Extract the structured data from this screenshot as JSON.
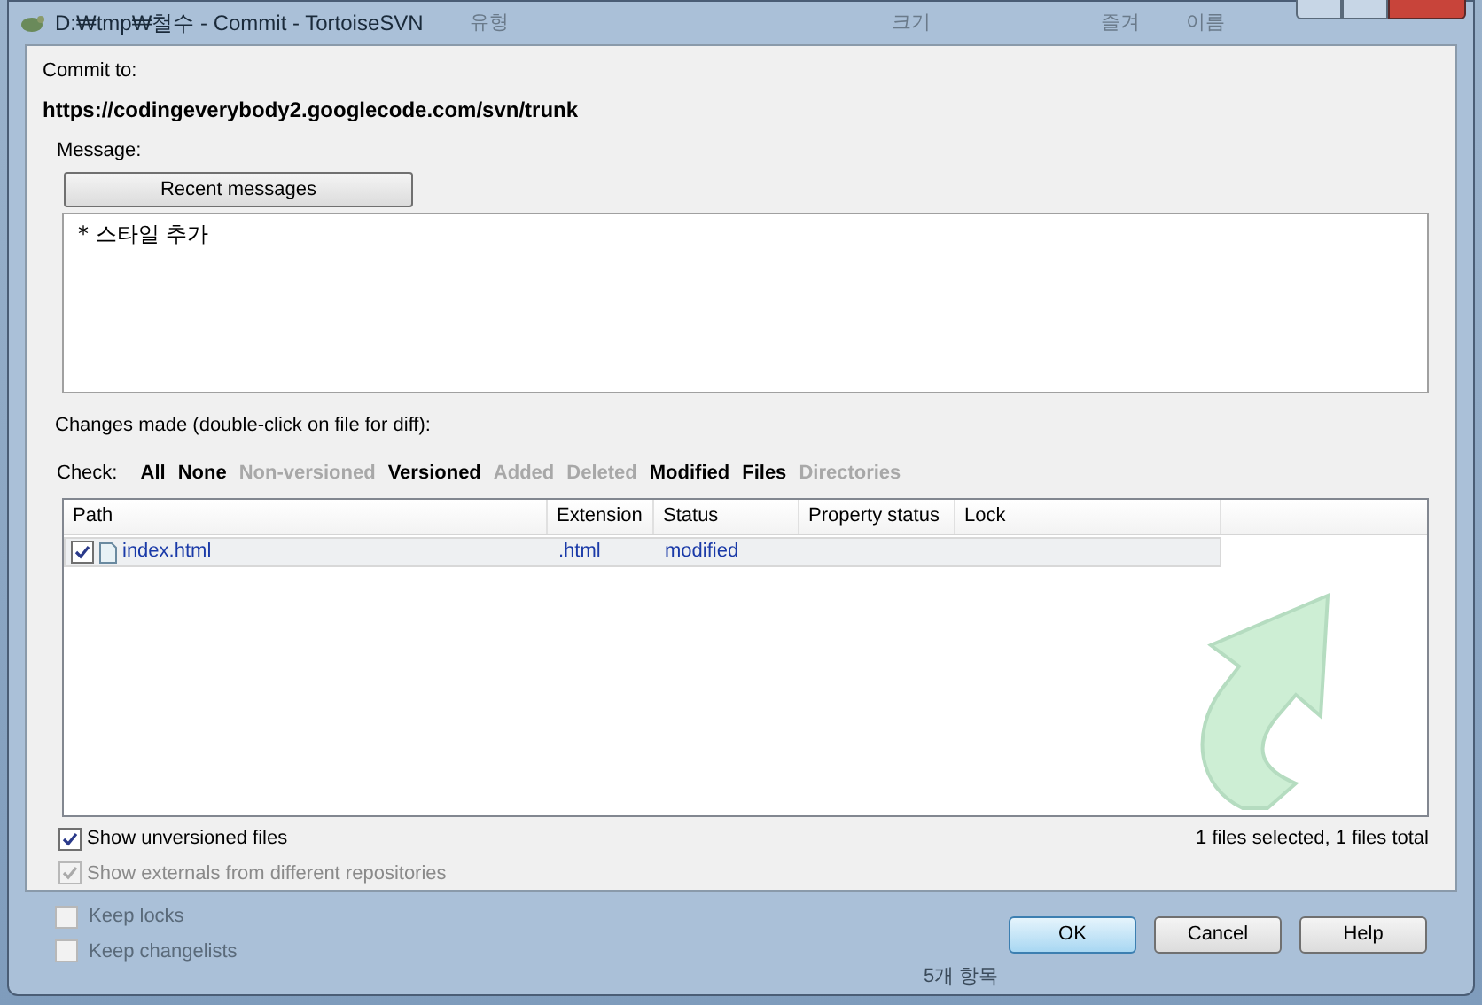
{
  "window": {
    "title": "D:₩tmp₩철수 - Commit - TortoiseSVN"
  },
  "background": {
    "header_texts": [
      "유형",
      "크기",
      "즐겨",
      "이름"
    ],
    "footer_text": "5개 항목"
  },
  "commit_to": {
    "label": "Commit to:",
    "url": "https://codingeverybody2.googlecode.com/svn/trunk"
  },
  "message": {
    "label": "Message:",
    "recent_button": "Recent messages",
    "value": "* 스타일 추가"
  },
  "changes": {
    "label": "Changes made (double-click on file for diff):",
    "check_label": "Check:",
    "filters": [
      {
        "label": "All",
        "enabled": true
      },
      {
        "label": "None",
        "enabled": true
      },
      {
        "label": "Non-versioned",
        "enabled": false
      },
      {
        "label": "Versioned",
        "enabled": true
      },
      {
        "label": "Added",
        "enabled": false
      },
      {
        "label": "Deleted",
        "enabled": false
      },
      {
        "label": "Modified",
        "enabled": true
      },
      {
        "label": "Files",
        "enabled": true
      },
      {
        "label": "Directories",
        "enabled": false
      }
    ],
    "columns": [
      "Path",
      "Extension",
      "Status",
      "Property status",
      "Lock"
    ],
    "rows": [
      {
        "checked": true,
        "selected": true,
        "path": "index.html",
        "extension": ".html",
        "status": "modified"
      }
    ]
  },
  "options": [
    {
      "label": "Show unversioned files",
      "checked": true,
      "disabled": false
    },
    {
      "label": "Show externals from different repositories",
      "checked": true,
      "disabled": true
    }
  ],
  "summary": "1 files selected, 1 files total",
  "bottom_options": [
    {
      "label": "Keep locks",
      "checked": false
    },
    {
      "label": "Keep changelists",
      "checked": false
    }
  ],
  "buttons": [
    {
      "label": "OK",
      "default": true
    },
    {
      "label": "Cancel",
      "default": false
    },
    {
      "label": "Help",
      "default": false
    }
  ]
}
